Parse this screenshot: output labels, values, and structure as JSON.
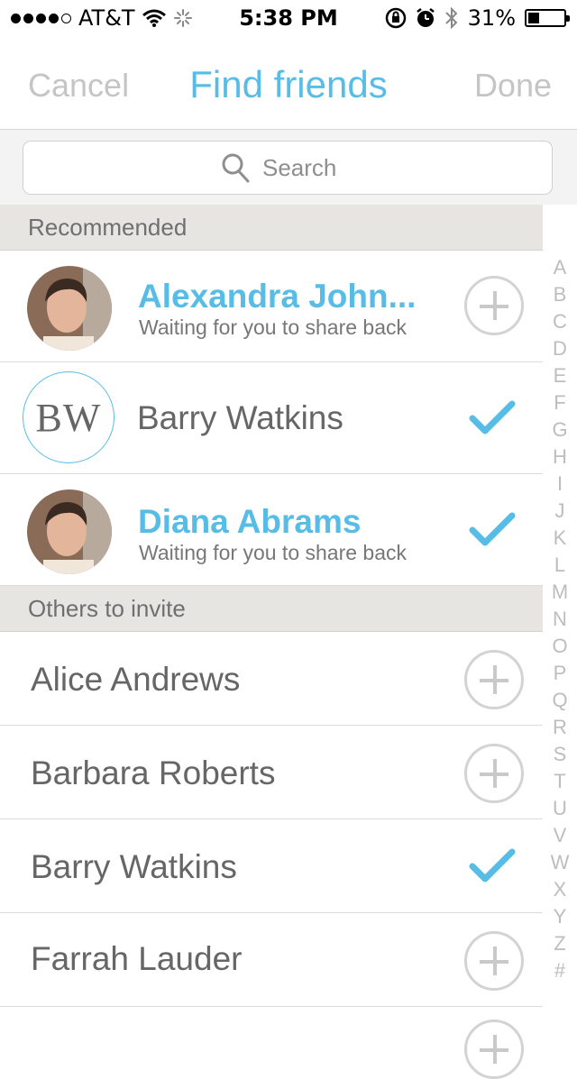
{
  "status_bar": {
    "carrier": "AT&T",
    "time": "5:38 PM",
    "battery": "31%",
    "battery_level": 0.31
  },
  "nav": {
    "cancel": "Cancel",
    "title": "Find friends",
    "done": "Done"
  },
  "search": {
    "placeholder": "Search"
  },
  "sections": {
    "recommended": "Recommended",
    "others": "Others to invite"
  },
  "recommended": [
    {
      "name": "Alexandra John...",
      "subtitle": "Waiting for you to share back",
      "action": "add"
    },
    {
      "initials": "BW",
      "name": "Barry Watkins",
      "action": "added"
    },
    {
      "name": "Diana Abrams",
      "subtitle": "Waiting for you to share back",
      "action": "added"
    }
  ],
  "others": [
    {
      "name": "Alice Andrews",
      "action": "add"
    },
    {
      "name": "Barbara Roberts",
      "action": "add"
    },
    {
      "name": "Barry Watkins",
      "action": "added"
    },
    {
      "name": "Farrah Lauder",
      "action": "add"
    }
  ],
  "index_letters": [
    "A",
    "B",
    "C",
    "D",
    "E",
    "F",
    "G",
    "H",
    "I",
    "J",
    "K",
    "L",
    "M",
    "N",
    "O",
    "P",
    "Q",
    "R",
    "S",
    "T",
    "U",
    "V",
    "W",
    "X",
    "Y",
    "Z",
    "#"
  ],
  "colors": {
    "accent": "#58bde6",
    "muted": "#c5c5c5",
    "section_bg": "#e7e5e1"
  },
  "icons": {
    "add": "plus-circle-icon",
    "added": "checkmark-icon",
    "search": "magnifier-icon"
  }
}
